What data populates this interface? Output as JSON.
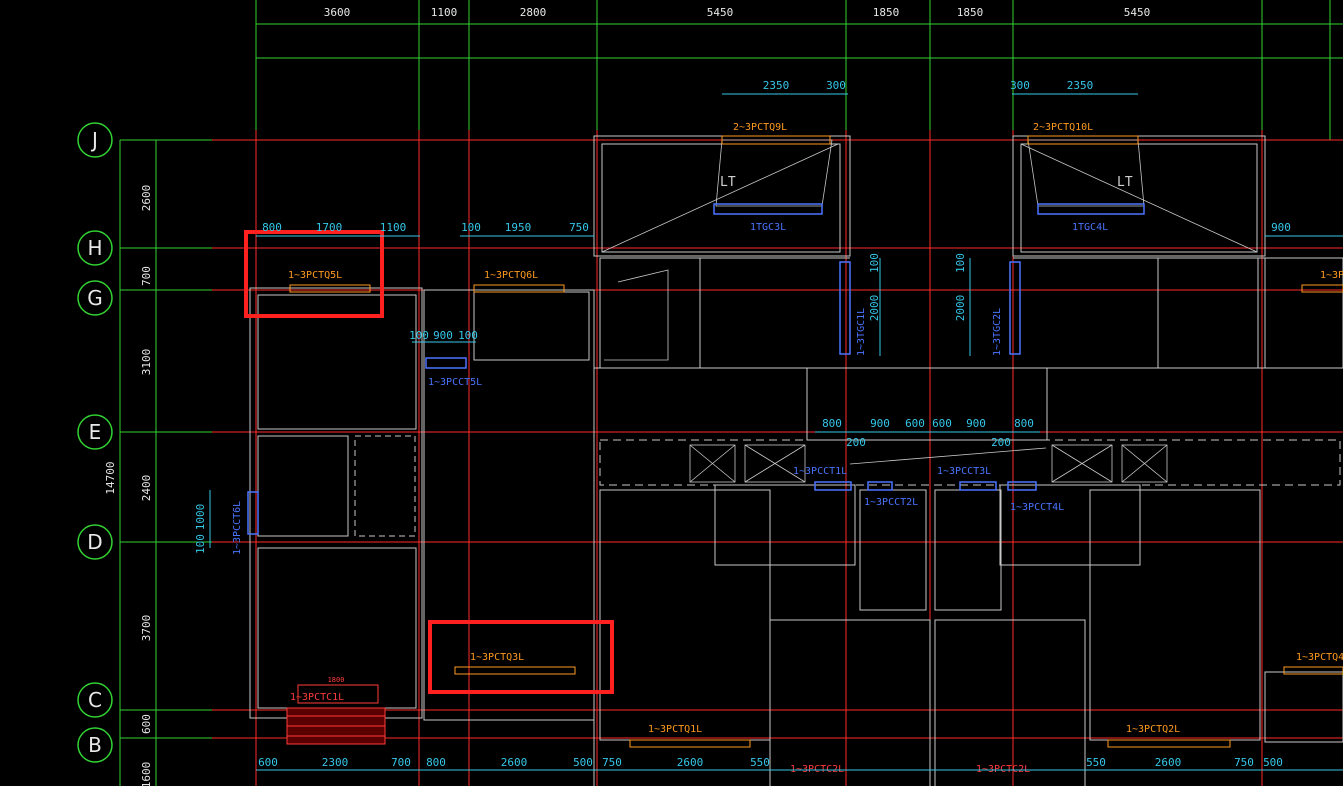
{
  "colors": {
    "background": "#000000",
    "axis_line": "#ff2a2a",
    "grid_line": "#32d232",
    "wall": "#c8c8c8",
    "dim": "#35c7e8",
    "label_orange": "#ff9a1f",
    "label_blue": "#4a74ff",
    "highlight": "#ff2020"
  },
  "top_dims": [
    "3600",
    "1100",
    "2800",
    "5450",
    "1850",
    "1850",
    "5450"
  ],
  "axes": [
    "J",
    "H",
    "G",
    "E",
    "D",
    "C",
    "B"
  ],
  "left_dims": [
    "2600",
    "700",
    "3100",
    "2400",
    "3700",
    "600",
    "1600"
  ],
  "left_total": "14700",
  "bottom_dims": [
    "600",
    "2300",
    "700",
    "800",
    "2600",
    "500",
    "750",
    "2600",
    "550",
    "550",
    "2600",
    "750",
    "500"
  ],
  "window_labels": {
    "w1": "2~3PCTQ9L",
    "w2": "2~3PCTQ10L",
    "w3": "1~3PCTQ5L",
    "w4": "1~3PCTQ6L",
    "w5": "1~3PCCT5L",
    "w6": "1~3PCTQ3L",
    "w7": "1~3PCTC1L",
    "w8": "1~3PCTQ1L",
    "w9": "1~3PCTQ2L",
    "w10": "1~3PCTC2L",
    "w11": "1~3PCTC2L",
    "w12": "1~3PCTQ4",
    "w13": "1~3PCCT1L",
    "w14": "1~3PCCT3L",
    "w15": "1~3PCCT2L",
    "w16": "1~3PCCT4L",
    "w17": "1~3PCCT6L",
    "w18": "1TGC3L",
    "w19": "1TGC4L",
    "w20": "1~3TGC1L",
    "w21": "1~3TGC2L",
    "w22": "1~3PC"
  },
  "stair_labels": [
    "LT",
    "LT"
  ],
  "inner_dims": {
    "d2350a": "2350",
    "d300a": "300",
    "d300b": "300",
    "d2350b": "2350",
    "d800": "800",
    "d1700": "1700",
    "d1100": "1100",
    "d100a": "100",
    "d1950": "1950",
    "d750": "750",
    "d900r": "900",
    "d100b": "100",
    "d900b": "900",
    "d100c": "100",
    "d100v1": "100",
    "d2000a": "2000",
    "d100v2": "100",
    "d2000b": "2000",
    "c800a": "800",
    "c900a": "900",
    "c600a": "600",
    "c600b": "600",
    "c900b": "900",
    "c800b": "800",
    "c200a": "200",
    "c200b": "200",
    "v1000": "1000",
    "v100": "100",
    "w1800": "1800"
  }
}
